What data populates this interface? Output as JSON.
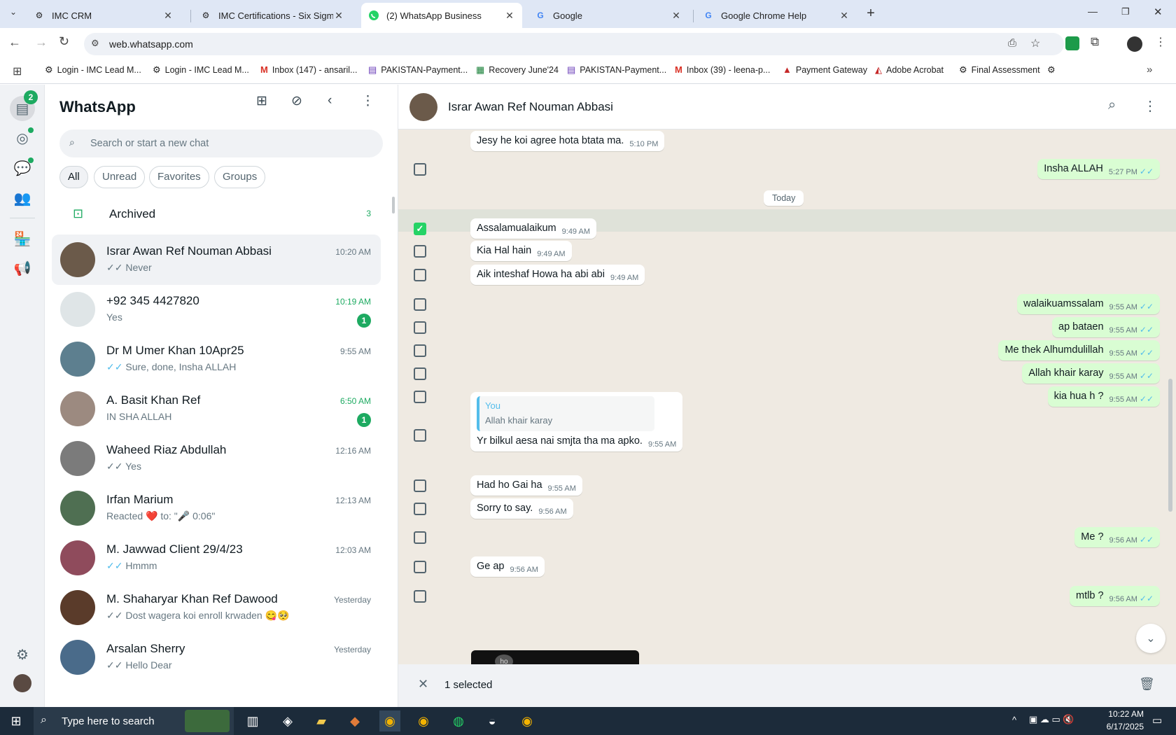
{
  "browser": {
    "tabs": [
      {
        "title": "IMC CRM",
        "active": false
      },
      {
        "title": "IMC Certifications - Six Sigma G",
        "active": false
      },
      {
        "title": "(2) WhatsApp Business",
        "active": true
      },
      {
        "title": "Google",
        "active": false
      },
      {
        "title": "Google Chrome Help",
        "active": false
      }
    ],
    "new_tab": "+",
    "url": "web.whatsapp.com",
    "bookmarks": [
      {
        "label": "Login - IMC Lead M...",
        "icon": "imc-icon"
      },
      {
        "label": "Login - IMC Lead M...",
        "icon": "imc-icon"
      },
      {
        "label": "Inbox (147) - ansaril...",
        "icon": "gmail-icon"
      },
      {
        "label": "PAKISTAN-Payment...",
        "icon": "forms-icon"
      },
      {
        "label": "Recovery June'24",
        "icon": "sheets-icon"
      },
      {
        "label": "PAKISTAN-Payment...",
        "icon": "forms-icon"
      },
      {
        "label": "Inbox (39) - leena-p...",
        "icon": "gmail-icon"
      },
      {
        "label": "Payment Gateway",
        "icon": "triangle-icon"
      },
      {
        "label": "Adobe Acrobat",
        "icon": "acrobat-icon"
      },
      {
        "label": "Final Assessment",
        "icon": "imc-icon"
      }
    ]
  },
  "whatsapp": {
    "rail_badge": "2",
    "title": "WhatsApp",
    "search_placeholder": "Search or start a new chat",
    "filters": [
      "All",
      "Unread",
      "Favorites",
      "Groups"
    ],
    "archived": {
      "label": "Archived",
      "count": "3"
    },
    "chats": [
      {
        "name": "Israr Awan Ref Nouman Abbasi",
        "preview": "Never",
        "time": "10:20 AM",
        "tick": "grey",
        "unread": null,
        "selected": true,
        "avatar_color": "#6b5a4a"
      },
      {
        "name": "+92 345 4427820",
        "preview": "Yes",
        "time": "10:19 AM",
        "tick": null,
        "unread": "1",
        "selected": false,
        "avatar_color": "#dfe5e7"
      },
      {
        "name": "Dr M Umer Khan 10Apr25",
        "preview": "Sure, done, Insha ALLAH",
        "time": "9:55 AM",
        "tick": "blue",
        "unread": null,
        "selected": false,
        "avatar_color": "#5d7f8f"
      },
      {
        "name": "A. Basit Khan Ref",
        "preview": "IN SHA ALLAH",
        "time": "6:50 AM",
        "tick": null,
        "unread": "1",
        "selected": false,
        "avatar_color": "#9c8a80"
      },
      {
        "name": "Waheed Riaz Abdullah",
        "preview": "Yes",
        "time": "12:16 AM",
        "tick": "grey",
        "unread": null,
        "selected": false,
        "avatar_color": "#7b7b7b"
      },
      {
        "name": "Irfan Marium",
        "preview": "Reacted ❤️ to: \"🎤 0:06\"",
        "time": "12:13 AM",
        "tick": null,
        "unread": null,
        "selected": false,
        "avatar_color": "#4f6f52"
      },
      {
        "name": "M. Jawwad Client 29/4/23",
        "preview": "Hmmm",
        "time": "12:03 AM",
        "tick": "blue",
        "unread": null,
        "selected": false,
        "avatar_color": "#8f4b5c"
      },
      {
        "name": "M. Shaharyar Khan Ref Dawood",
        "preview": "Dost wagera koi enroll krwaden 😋🥺",
        "time": "Yesterday",
        "tick": "grey",
        "unread": null,
        "selected": false,
        "avatar_color": "#5a3b2a"
      },
      {
        "name": "Arsalan Sherry",
        "preview": "Hello Dear",
        "time": "Yesterday",
        "tick": "grey",
        "unread": null,
        "selected": false,
        "avatar_color": "#4a6b8a"
      }
    ],
    "conversation": {
      "contact": "Israr Awan Ref Nouman Abbasi",
      "day_divider": "Today",
      "messages": [
        {
          "text": "Jesy he koi agree hota btata ma.",
          "time": "5:10 PM",
          "dir": "in",
          "checked": false
        },
        {
          "text": "Insha ALLAH",
          "time": "5:27 PM",
          "dir": "out",
          "checked": false
        },
        {
          "text": "Assalamualaikum",
          "time": "9:49 AM",
          "dir": "in",
          "checked": true
        },
        {
          "text": "Kia Hal hain",
          "time": "9:49 AM",
          "dir": "in",
          "checked": false
        },
        {
          "text": "Aik inteshaf Howa ha abi abi",
          "time": "9:49 AM",
          "dir": "in",
          "checked": false
        },
        {
          "text": "walaikuamssalam",
          "time": "9:55 AM",
          "dir": "out",
          "checked": false
        },
        {
          "text": "ap bataen",
          "time": "9:55 AM",
          "dir": "out",
          "checked": false
        },
        {
          "text": "Me thek Alhumdulillah",
          "time": "9:55 AM",
          "dir": "out",
          "checked": false
        },
        {
          "text": "Allah khair karay",
          "time": "9:55 AM",
          "dir": "out",
          "checked": false
        },
        {
          "text": "kia hua h ?",
          "time": "9:55 AM",
          "dir": "out",
          "checked": false
        },
        {
          "text": "Yr bilkul aesa nai smjta tha ma apko.",
          "time": "9:55 AM",
          "dir": "in",
          "checked": false,
          "quote_author": "You",
          "quote_text": "Allah khair karay"
        },
        {
          "text": "Had ho Gai ha",
          "time": "9:55 AM",
          "dir": "in",
          "checked": false
        },
        {
          "text": "Sorry to say.",
          "time": "9:56 AM",
          "dir": "in",
          "checked": false
        },
        {
          "text": "Me ?",
          "time": "9:56 AM",
          "dir": "out",
          "checked": false
        },
        {
          "text": "Ge ap",
          "time": "9:56 AM",
          "dir": "in",
          "checked": false
        },
        {
          "text": "mtlb ?",
          "time": "9:56 AM",
          "dir": "out",
          "checked": false
        }
      ],
      "media_label": "ho",
      "selection_text": "1 selected"
    }
  },
  "taskbar": {
    "search_placeholder": "Type here to search",
    "time": "10:22 AM",
    "date": "6/17/2025"
  }
}
